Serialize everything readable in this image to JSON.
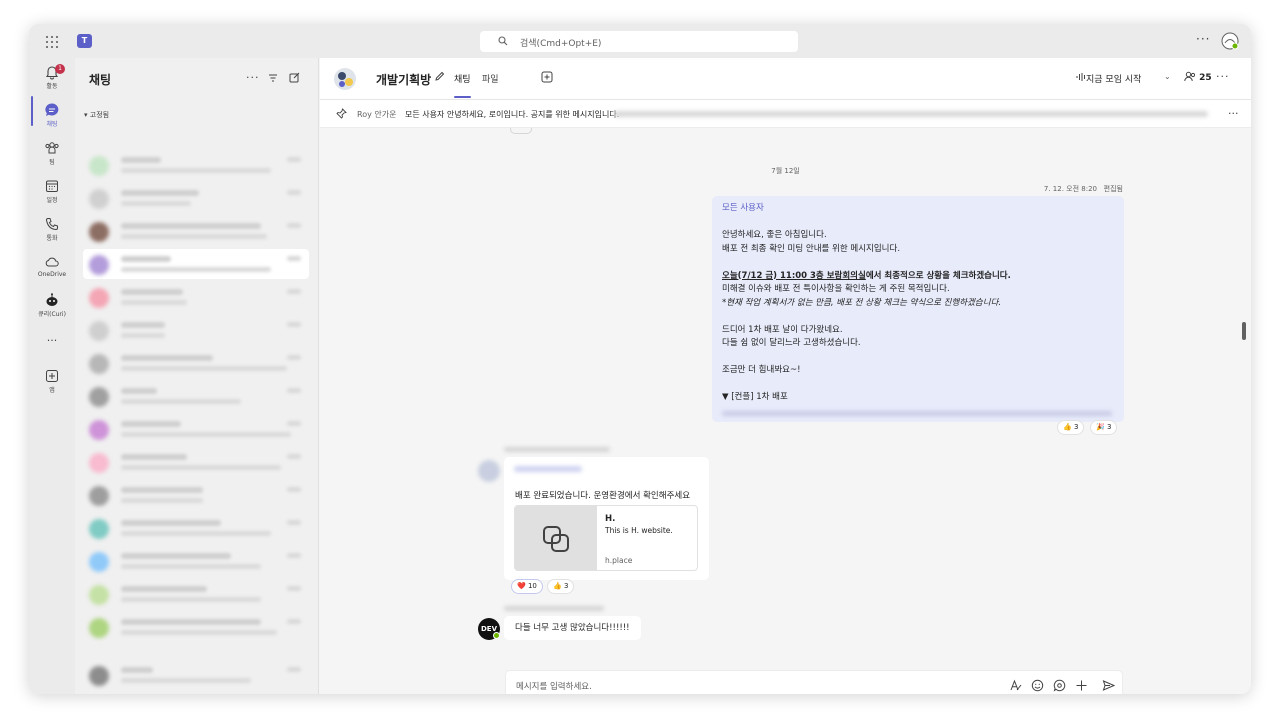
{
  "titlebar": {
    "search_placeholder": "검색(Cmd+Opt+E)",
    "more": "···"
  },
  "rail": {
    "activity_label": "활동",
    "activity_badge": "1",
    "chat_label": "채팅",
    "teams_label": "팀",
    "calendar_label": "일정",
    "calls_label": "통화",
    "onedrive_label": "OneDrive",
    "curi_label": "큐리(Curi)",
    "more_apps": "···",
    "apps_label": "앱"
  },
  "chat_list": {
    "title": "채팅",
    "more": "···",
    "pinned_label": "고정됨"
  },
  "chat_header": {
    "group_name": "개발기획방",
    "tabs": [
      {
        "label": "채팅"
      },
      {
        "label": "파일"
      }
    ],
    "meet_now": "지금 모임 시작",
    "participants": "25",
    "more": "···"
  },
  "pinned_message": {
    "author": "Roy 안가운",
    "text": "모든 사용자 안녕하세요, 로이입니다. 공지를 위한 메시지입니다."
  },
  "conversation": {
    "date_divider": "7월 12일",
    "my_message": {
      "timestamp": "7. 12. 오전 8:20",
      "edited": "편집됨",
      "mention": "모든 사용자",
      "line1": "안녕하세요, 좋은 아침입니다.",
      "line2": "배포 전 최종 확인 미팅 안내를 위한 메시지입니다.",
      "line3_bold_underline": "오늘(7/12 금) 11:00 3층 보람회의실",
      "line3_bold": "에서 최종적으로 상황을 체크하겠습니다.",
      "line4": "미해결 이슈와 배포 전 특이사항을 확인하는 게 주된 목적입니다.",
      "line5_italic": "*현재 작업 계획서가 없는 만큼, 배포 전 상황 체크는 약식으로 진행하겠습니다.",
      "line6": "드디어 1차 배포 날이 다가왔네요.",
      "line7": "다들 쉼 없이 달리느라 고생하셨습니다.",
      "line8": "조금만 더 힘내봐요~!",
      "collapsed_section": "▼ [컨플] 1차 배포",
      "reactions": [
        {
          "emoji": "👍",
          "count": "3"
        },
        {
          "emoji": "🎉",
          "count": "3"
        }
      ]
    },
    "other_message": {
      "text": "배포 완료되었습니다. 운영환경에서 확인해주세요",
      "link_card": {
        "title": "H.",
        "description": "This is H. website.",
        "domain": "h.place"
      },
      "reactions": [
        {
          "emoji": "❤️",
          "count": "10"
        },
        {
          "emoji": "👍",
          "count": "3"
        }
      ]
    },
    "dev_message": {
      "avatar_text": "DEV",
      "text": "다들 너무 고생 많았습니다!!!!!!"
    }
  },
  "composer": {
    "placeholder": "메시지를 입력하세요."
  },
  "colors": {
    "accent": "#5b5fc7",
    "my_bubble": "#e8ebfa",
    "badge": "#c4314b"
  }
}
